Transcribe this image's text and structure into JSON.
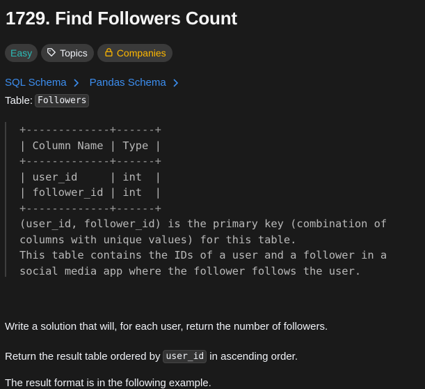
{
  "problem": {
    "title": "1729. Find Followers Count"
  },
  "tags": {
    "difficulty": "Easy",
    "topics": "Topics",
    "companies": "Companies",
    "icons": [
      "tag-icon",
      "lock-icon"
    ],
    "colors": {
      "easy": "#2cbbb6",
      "companies": "#ffb800",
      "link": "#3c8ef0"
    }
  },
  "schema": {
    "sql": "SQL Schema",
    "pandas": "Pandas Schema",
    "chevron_icon": "chevron-right-icon"
  },
  "table_line": {
    "label": "Table:",
    "name": "Followers"
  },
  "schema_block": {
    "lines": [
      "+-------------+------+",
      "| Column Name | Type |",
      "+-------------+------+",
      "| user_id     | int  |",
      "| follower_id | int  |",
      "+-------------+------+",
      "(user_id, follower_id) is the primary key (combination of",
      "columns with unique values) for this table.",
      "This table contains the IDs of a user and a follower in a",
      "social media app where the follower follows the user."
    ]
  },
  "description": {
    "p1": "Write a solution that will, for each user, return the number of followers.",
    "p2_before": "Return the result table ordered by",
    "p2_code": "user_id",
    "p2_after": "in ascending order.",
    "p3": "The result format is in the following example."
  }
}
